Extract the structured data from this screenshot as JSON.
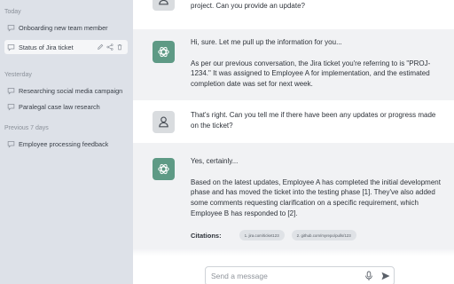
{
  "sidebar": {
    "groups": [
      {
        "label": "Today",
        "items": [
          {
            "label": "Onboarding new team member"
          },
          {
            "label": "Status of Jira ticket"
          }
        ]
      },
      {
        "label": "Yesterday",
        "items": [
          {
            "label": "Researching social media campaign"
          },
          {
            "label": "Paralegal case law research"
          }
        ]
      },
      {
        "label": "Previous 7 days",
        "items": [
          {
            "label": "Employee processing feedback"
          }
        ]
      }
    ]
  },
  "conversation": {
    "messages": [
      {
        "role": "user",
        "paragraphs": [
          "project. Can you provide an update?"
        ]
      },
      {
        "role": "assistant",
        "paragraphs": [
          "Hi, sure. Let me pull up the information for you...",
          "As per our previous conversation, the Jira ticket you're referring to is \"PROJ-1234.\" It was assigned to Employee A for implementation, and the estimated completion date was set for next week."
        ]
      },
      {
        "role": "user",
        "paragraphs": [
          "That's right. Can you tell me if there have been any updates or progress made on the ticket?"
        ]
      },
      {
        "role": "assistant",
        "paragraphs": [
          "Yes, certainly...",
          "Based on the latest updates, Employee A has completed the initial development phase and has moved the ticket into the testing phase [1]. They've also added some comments requesting clarification on a specific requirement, which Employee B has responded to [2]."
        ]
      }
    ],
    "citations_label": "Citations:",
    "citations": [
      "1. jira.com/ticket123",
      "2. github.com/myrepo/pulls/123"
    ]
  },
  "composer": {
    "placeholder": "Send a message"
  },
  "colors": {
    "sidebar_bg": "#dde1e8",
    "bot_avatar": "#5e9a85",
    "assistant_bg": "#f1f2f4"
  }
}
